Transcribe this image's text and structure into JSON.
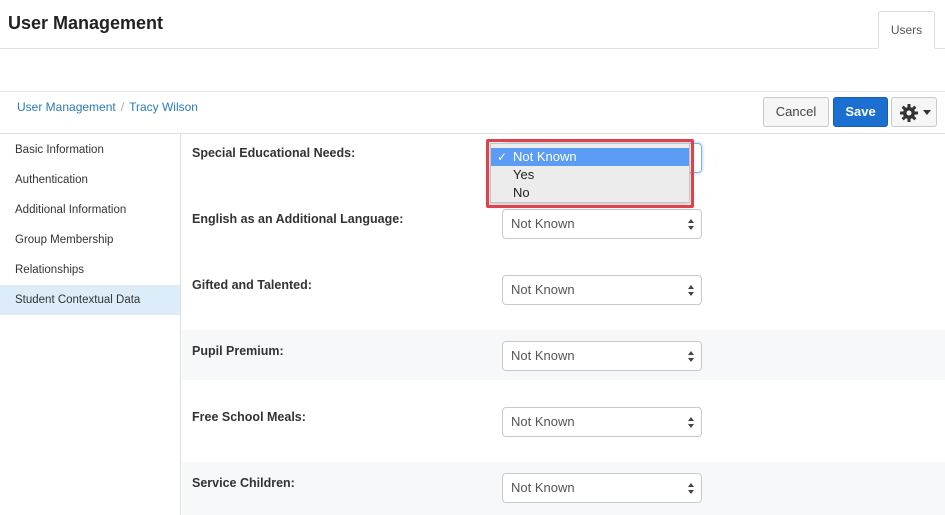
{
  "header": {
    "title": "User Management",
    "tab_label": "Users"
  },
  "breadcrumb": {
    "root": "User Management",
    "separator": "/",
    "current": "Tracy Wilson"
  },
  "toolbar": {
    "cancel_label": "Cancel",
    "save_label": "Save",
    "settings_icon": "gear-icon"
  },
  "sidebar": {
    "items": [
      {
        "label": "Basic Information",
        "active": false
      },
      {
        "label": "Authentication",
        "active": false
      },
      {
        "label": "Additional Information",
        "active": false
      },
      {
        "label": "Group Membership",
        "active": false
      },
      {
        "label": "Relationships",
        "active": false
      },
      {
        "label": "Student Contextual Data",
        "active": true
      }
    ]
  },
  "form": {
    "fields": [
      {
        "label": "Special Educational Needs:",
        "value": "Not Known"
      },
      {
        "label": "English as an Additional Language:",
        "value": "Not Known"
      },
      {
        "label": "Gifted and Talented:",
        "value": "Not Known"
      },
      {
        "label": "Pupil Premium:",
        "value": "Not Known"
      },
      {
        "label": "Free School Meals:",
        "value": "Not Known"
      },
      {
        "label": "Service Children:",
        "value": "Not Known"
      }
    ],
    "open_dropdown": {
      "check": "✓",
      "options": [
        "Not Known",
        "Yes",
        "No"
      ],
      "selected": "Not Known"
    }
  },
  "colors": {
    "accent": "#1a6fd1",
    "link": "#2a7ab8",
    "active_side": "#dcedf9",
    "highlight": "#e0424b",
    "option_selected": "#5b9cf4"
  }
}
